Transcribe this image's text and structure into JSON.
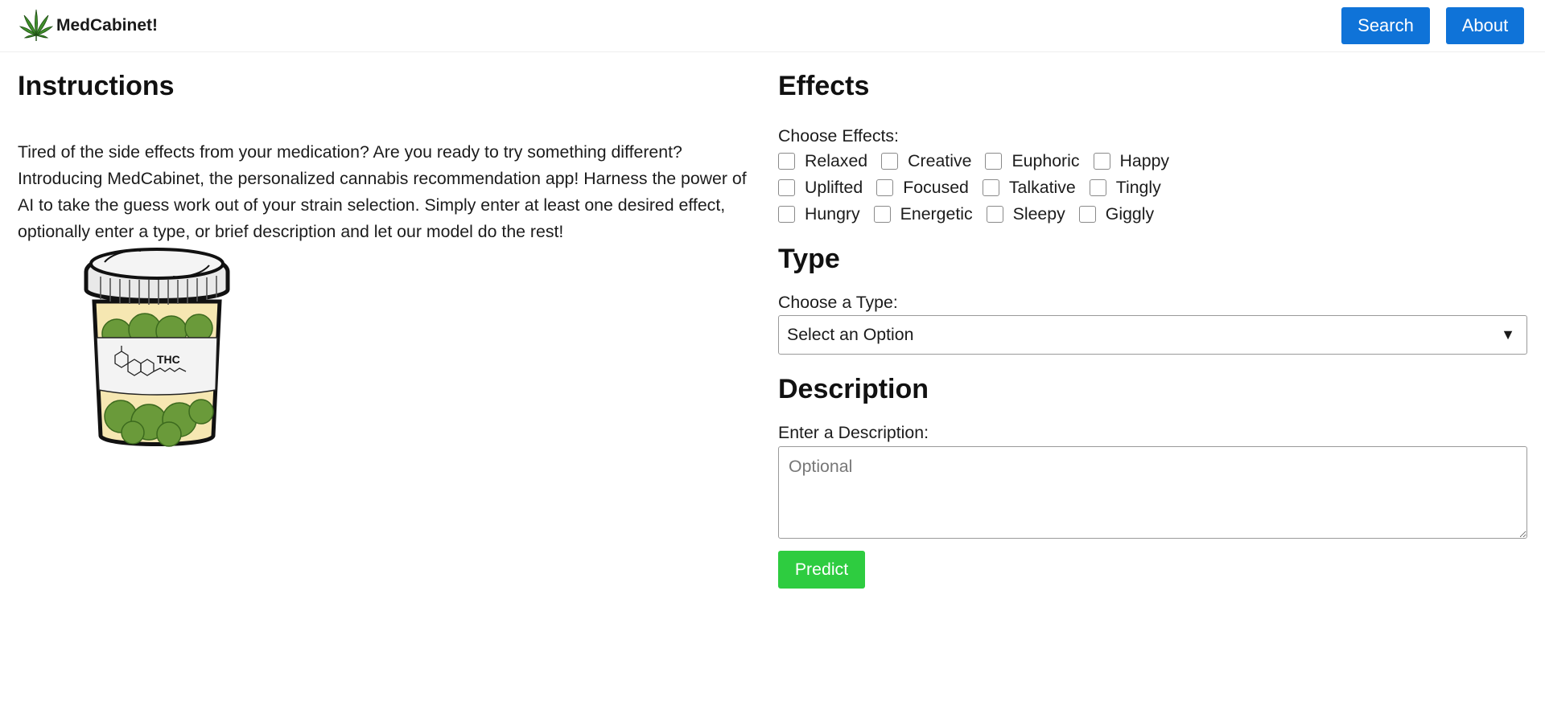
{
  "header": {
    "brand_name": "MedCabinet!",
    "logo_icon": "cannabis-leaf-icon",
    "nav": {
      "search_label": "Search",
      "about_label": "About"
    },
    "accent_color": "#0f73d8"
  },
  "instructions": {
    "title": "Instructions",
    "text": "Tired of the side effects from your medication? Are you ready to try something different? Introducing MedCabinet, the personalized cannabis recommendation app! Harness the power of AI to take the guess work out of your strain selection. Simply enter at least one desired effect, optionally enter a type, or brief description and let our model do the rest!",
    "image": "cannabis-pill-jar-illustration"
  },
  "effects": {
    "title": "Effects",
    "label": "Choose Effects:",
    "rows": [
      [
        "Relaxed",
        "Creative",
        "Euphoric",
        "Happy"
      ],
      [
        "Uplifted",
        "Focused",
        "Talkative",
        "Tingly"
      ],
      [
        "Hungry",
        "Energetic",
        "Sleepy",
        "Giggly"
      ]
    ]
  },
  "type": {
    "title": "Type",
    "label": "Choose a Type:",
    "selected": "Select an Option"
  },
  "description": {
    "title": "Description",
    "label": "Enter a Description:",
    "placeholder": "Optional"
  },
  "predict": {
    "label": "Predict",
    "color": "#2ecc40"
  }
}
